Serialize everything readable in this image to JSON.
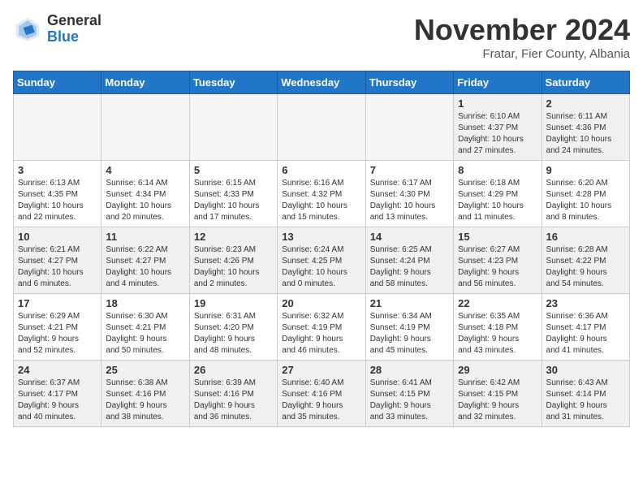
{
  "logo": {
    "general": "General",
    "blue": "Blue"
  },
  "title": "November 2024",
  "location": "Fratar, Fier County, Albania",
  "days_of_week": [
    "Sunday",
    "Monday",
    "Tuesday",
    "Wednesday",
    "Thursday",
    "Friday",
    "Saturday"
  ],
  "weeks": [
    [
      {
        "day": "",
        "info": "",
        "empty": true
      },
      {
        "day": "",
        "info": "",
        "empty": true
      },
      {
        "day": "",
        "info": "",
        "empty": true
      },
      {
        "day": "",
        "info": "",
        "empty": true
      },
      {
        "day": "",
        "info": "",
        "empty": true
      },
      {
        "day": "1",
        "info": "Sunrise: 6:10 AM\nSunset: 4:37 PM\nDaylight: 10 hours\nand 27 minutes."
      },
      {
        "day": "2",
        "info": "Sunrise: 6:11 AM\nSunset: 4:36 PM\nDaylight: 10 hours\nand 24 minutes."
      }
    ],
    [
      {
        "day": "3",
        "info": "Sunrise: 6:13 AM\nSunset: 4:35 PM\nDaylight: 10 hours\nand 22 minutes."
      },
      {
        "day": "4",
        "info": "Sunrise: 6:14 AM\nSunset: 4:34 PM\nDaylight: 10 hours\nand 20 minutes."
      },
      {
        "day": "5",
        "info": "Sunrise: 6:15 AM\nSunset: 4:33 PM\nDaylight: 10 hours\nand 17 minutes."
      },
      {
        "day": "6",
        "info": "Sunrise: 6:16 AM\nSunset: 4:32 PM\nDaylight: 10 hours\nand 15 minutes."
      },
      {
        "day": "7",
        "info": "Sunrise: 6:17 AM\nSunset: 4:30 PM\nDaylight: 10 hours\nand 13 minutes."
      },
      {
        "day": "8",
        "info": "Sunrise: 6:18 AM\nSunset: 4:29 PM\nDaylight: 10 hours\nand 11 minutes."
      },
      {
        "day": "9",
        "info": "Sunrise: 6:20 AM\nSunset: 4:28 PM\nDaylight: 10 hours\nand 8 minutes."
      }
    ],
    [
      {
        "day": "10",
        "info": "Sunrise: 6:21 AM\nSunset: 4:27 PM\nDaylight: 10 hours\nand 6 minutes."
      },
      {
        "day": "11",
        "info": "Sunrise: 6:22 AM\nSunset: 4:27 PM\nDaylight: 10 hours\nand 4 minutes."
      },
      {
        "day": "12",
        "info": "Sunrise: 6:23 AM\nSunset: 4:26 PM\nDaylight: 10 hours\nand 2 minutes."
      },
      {
        "day": "13",
        "info": "Sunrise: 6:24 AM\nSunset: 4:25 PM\nDaylight: 10 hours\nand 0 minutes."
      },
      {
        "day": "14",
        "info": "Sunrise: 6:25 AM\nSunset: 4:24 PM\nDaylight: 9 hours\nand 58 minutes."
      },
      {
        "day": "15",
        "info": "Sunrise: 6:27 AM\nSunset: 4:23 PM\nDaylight: 9 hours\nand 56 minutes."
      },
      {
        "day": "16",
        "info": "Sunrise: 6:28 AM\nSunset: 4:22 PM\nDaylight: 9 hours\nand 54 minutes."
      }
    ],
    [
      {
        "day": "17",
        "info": "Sunrise: 6:29 AM\nSunset: 4:21 PM\nDaylight: 9 hours\nand 52 minutes."
      },
      {
        "day": "18",
        "info": "Sunrise: 6:30 AM\nSunset: 4:21 PM\nDaylight: 9 hours\nand 50 minutes."
      },
      {
        "day": "19",
        "info": "Sunrise: 6:31 AM\nSunset: 4:20 PM\nDaylight: 9 hours\nand 48 minutes."
      },
      {
        "day": "20",
        "info": "Sunrise: 6:32 AM\nSunset: 4:19 PM\nDaylight: 9 hours\nand 46 minutes."
      },
      {
        "day": "21",
        "info": "Sunrise: 6:34 AM\nSunset: 4:19 PM\nDaylight: 9 hours\nand 45 minutes."
      },
      {
        "day": "22",
        "info": "Sunrise: 6:35 AM\nSunset: 4:18 PM\nDaylight: 9 hours\nand 43 minutes."
      },
      {
        "day": "23",
        "info": "Sunrise: 6:36 AM\nSunset: 4:17 PM\nDaylight: 9 hours\nand 41 minutes."
      }
    ],
    [
      {
        "day": "24",
        "info": "Sunrise: 6:37 AM\nSunset: 4:17 PM\nDaylight: 9 hours\nand 40 minutes."
      },
      {
        "day": "25",
        "info": "Sunrise: 6:38 AM\nSunset: 4:16 PM\nDaylight: 9 hours\nand 38 minutes."
      },
      {
        "day": "26",
        "info": "Sunrise: 6:39 AM\nSunset: 4:16 PM\nDaylight: 9 hours\nand 36 minutes."
      },
      {
        "day": "27",
        "info": "Sunrise: 6:40 AM\nSunset: 4:16 PM\nDaylight: 9 hours\nand 35 minutes."
      },
      {
        "day": "28",
        "info": "Sunrise: 6:41 AM\nSunset: 4:15 PM\nDaylight: 9 hours\nand 33 minutes."
      },
      {
        "day": "29",
        "info": "Sunrise: 6:42 AM\nSunset: 4:15 PM\nDaylight: 9 hours\nand 32 minutes."
      },
      {
        "day": "30",
        "info": "Sunrise: 6:43 AM\nSunset: 4:14 PM\nDaylight: 9 hours\nand 31 minutes."
      }
    ]
  ]
}
